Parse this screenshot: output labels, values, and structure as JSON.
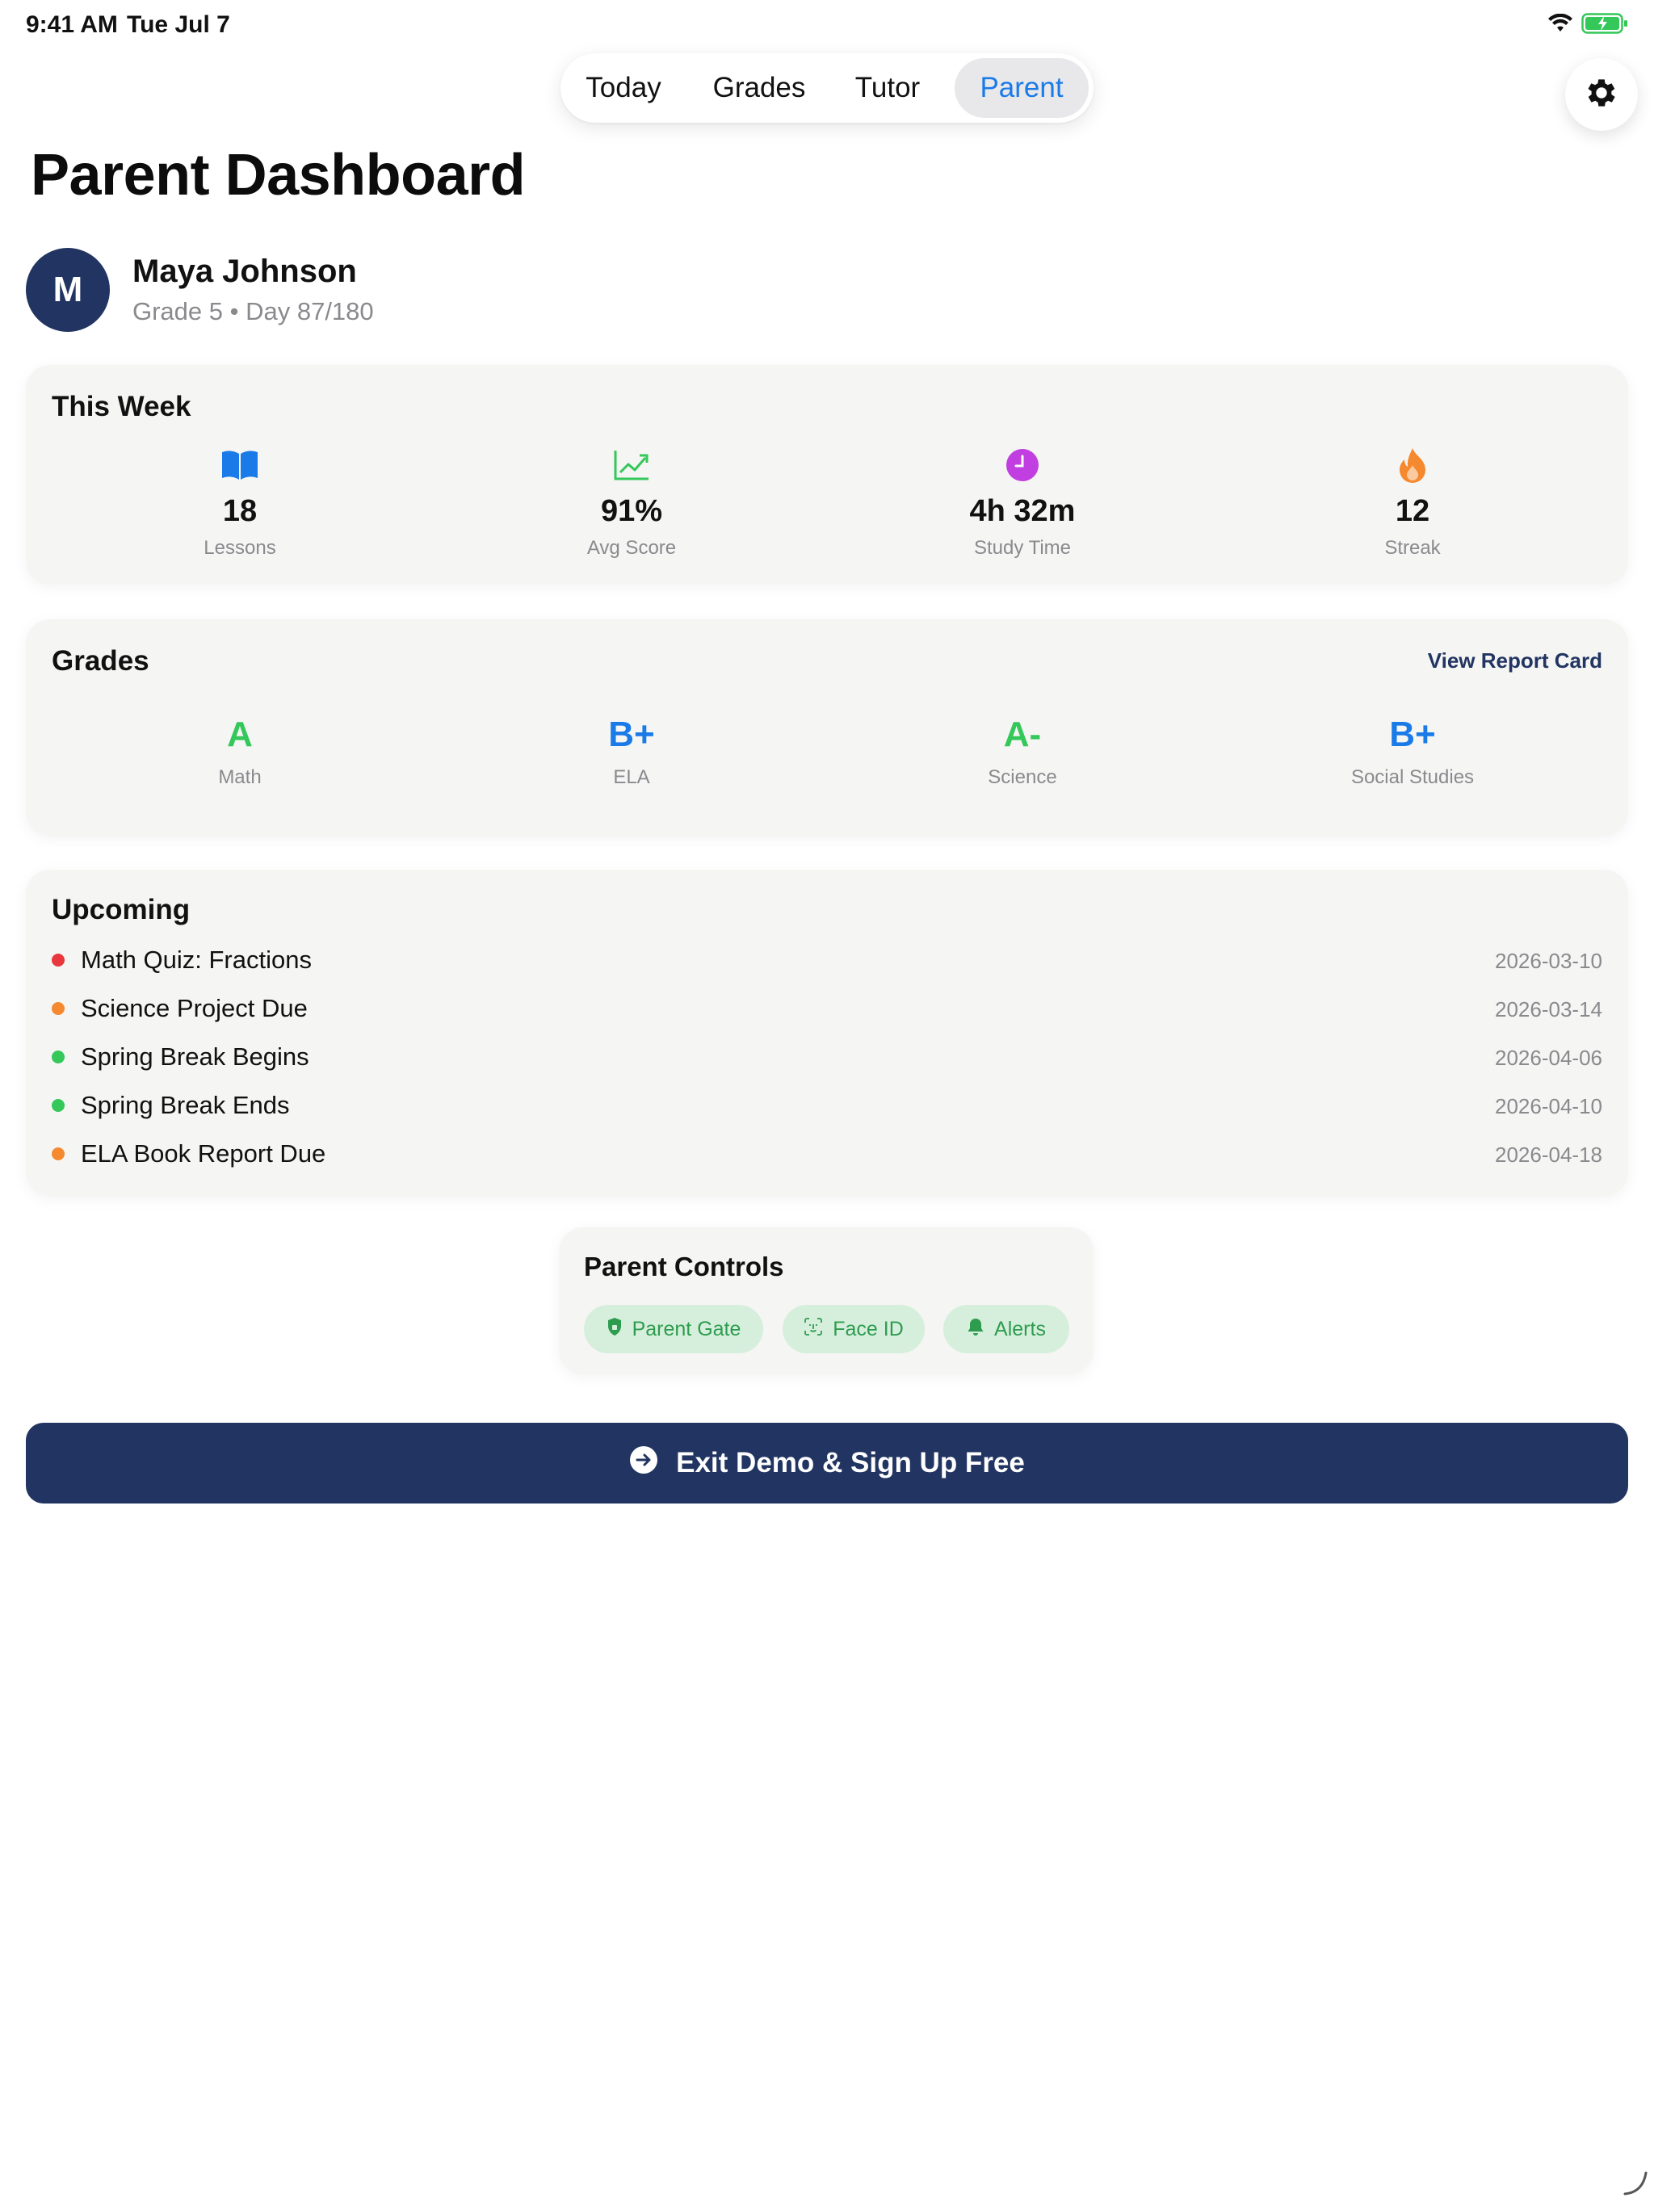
{
  "status_bar": {
    "time": "9:41 AM",
    "date": "Tue Jul 7"
  },
  "nav": {
    "tabs": [
      {
        "label": "Today",
        "selected": false
      },
      {
        "label": "Grades",
        "selected": false
      },
      {
        "label": "Tutor",
        "selected": false
      },
      {
        "label": "Parent",
        "selected": true
      }
    ]
  },
  "page": {
    "title": "Parent Dashboard"
  },
  "student": {
    "initial": "M",
    "name": "Maya Johnson",
    "meta": "Grade 5 • Day 87/180"
  },
  "this_week": {
    "title": "This Week",
    "stats": [
      {
        "icon": "book-icon",
        "value": "18",
        "label": "Lessons",
        "color": "#1a7be8"
      },
      {
        "icon": "trend-chart-icon",
        "value": "91%",
        "label": "Avg Score",
        "color": "#34c759"
      },
      {
        "icon": "clock-icon",
        "value": "4h 32m",
        "label": "Study Time",
        "color": "#c13ee0"
      },
      {
        "icon": "flame-icon",
        "value": "12",
        "label": "Streak",
        "color": "#f5892f"
      }
    ]
  },
  "grades": {
    "title": "Grades",
    "report_link": "View Report Card",
    "items": [
      {
        "letter": "A",
        "subject": "Math",
        "color": "#34c759"
      },
      {
        "letter": "B+",
        "subject": "ELA",
        "color": "#1a7be8"
      },
      {
        "letter": "A-",
        "subject": "Science",
        "color": "#34c759"
      },
      {
        "letter": "B+",
        "subject": "Social Studies",
        "color": "#1a7be8"
      }
    ]
  },
  "upcoming": {
    "title": "Upcoming",
    "items": [
      {
        "title": "Math Quiz: Fractions",
        "date": "2026-03-10",
        "color": "#e8383d"
      },
      {
        "title": "Science Project Due",
        "date": "2026-03-14",
        "color": "#f5892f"
      },
      {
        "title": "Spring Break Begins",
        "date": "2026-04-06",
        "color": "#34c759"
      },
      {
        "title": "Spring Break Ends",
        "date": "2026-04-10",
        "color": "#34c759"
      },
      {
        "title": "ELA Book Report Due",
        "date": "2026-04-18",
        "color": "#f5892f"
      }
    ]
  },
  "parent_controls": {
    "title": "Parent Controls",
    "pills": [
      {
        "icon": "shield-icon",
        "label": "Parent Gate"
      },
      {
        "icon": "face-id-icon",
        "label": "Face ID"
      },
      {
        "icon": "bell-icon",
        "label": "Alerts"
      }
    ]
  },
  "cta": {
    "icon": "arrow-right-circle-icon",
    "label": "Exit Demo & Sign Up Free"
  },
  "colors": {
    "navy": "#223461",
    "accent_blue": "#1a7be8",
    "green": "#34c759",
    "card_bg": "#f5f5f4"
  }
}
